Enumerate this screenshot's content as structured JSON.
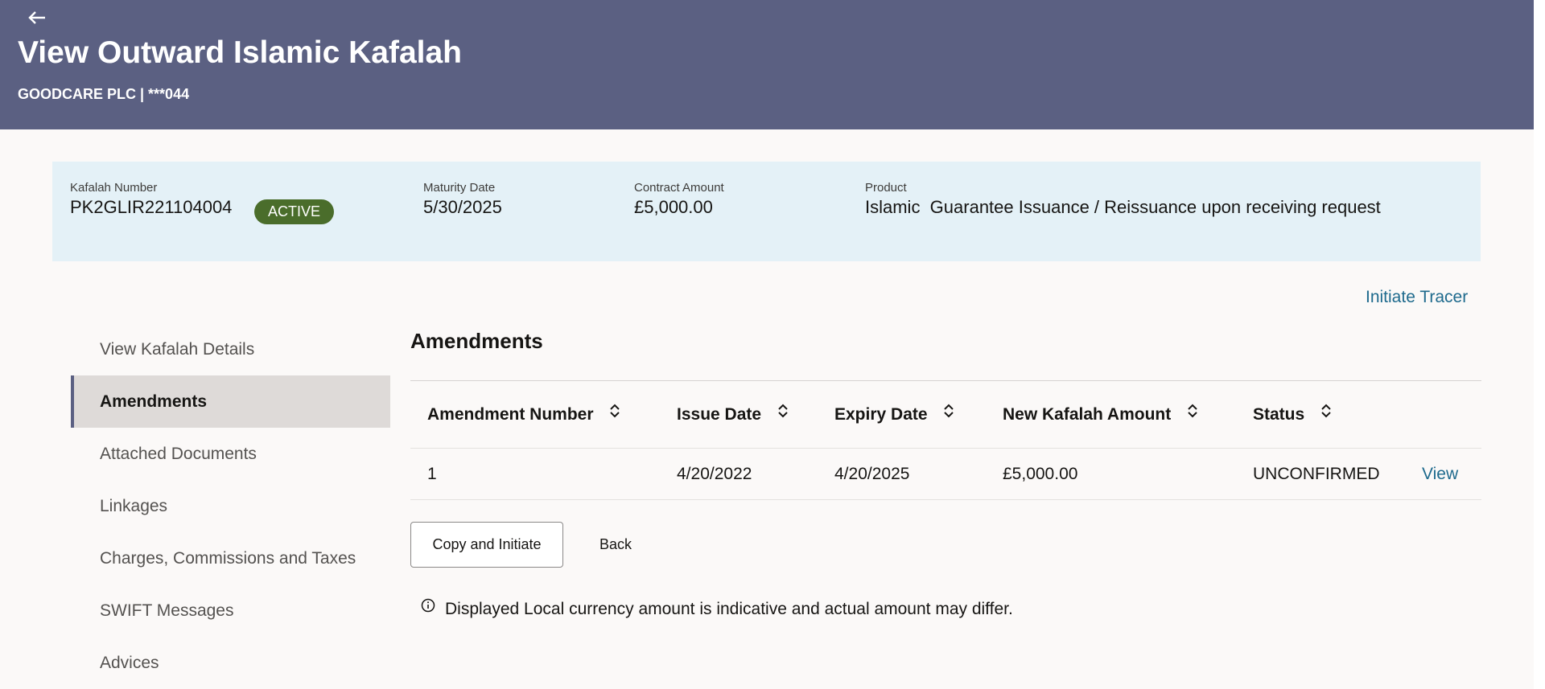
{
  "header": {
    "title": "View Outward Islamic Kafalah",
    "subtitle": "GOODCARE PLC | ***044",
    "back_icon": "back-arrow-icon"
  },
  "summary": {
    "kafalah_number_label": "Kafalah Number",
    "kafalah_number": "PK2GLIR221104004",
    "status_badge": "ACTIVE",
    "maturity_date_label": "Maturity Date",
    "maturity_date": "5/30/2025",
    "contract_amount_label": "Contract Amount",
    "contract_amount": "£5,000.00",
    "product_label": "Product",
    "product": "Islamic  Guarantee Issuance / Reissuance upon receiving request"
  },
  "actions": {
    "initiate_tracer": "Initiate Tracer"
  },
  "sidebar": {
    "items": [
      {
        "label": "View Kafalah Details",
        "active": false
      },
      {
        "label": "Amendments",
        "active": true
      },
      {
        "label": "Attached Documents",
        "active": false
      },
      {
        "label": "Linkages",
        "active": false
      },
      {
        "label": "Charges, Commissions and Taxes",
        "active": false
      },
      {
        "label": "SWIFT Messages",
        "active": false
      },
      {
        "label": "Advices",
        "active": false
      }
    ]
  },
  "main": {
    "section_title": "Amendments",
    "table": {
      "columns": [
        "Amendment Number",
        "Issue Date",
        "Expiry Date",
        "New Kafalah Amount",
        "Status"
      ],
      "rows": [
        {
          "amendment_number": "1",
          "issue_date": "4/20/2022",
          "expiry_date": "4/20/2025",
          "new_amount": "£5,000.00",
          "status": "UNCONFIRMED",
          "action": "View"
        }
      ]
    },
    "buttons": {
      "copy_and_initiate": "Copy and Initiate",
      "back": "Back"
    },
    "note": "Displayed Local currency amount is indicative and actual amount may differ."
  },
  "colors": {
    "header_bg": "#5b6082",
    "summary_bg": "#e4f1f7",
    "badge_bg": "#4a6d2b",
    "link": "#1e6a8d",
    "active_nav_bg": "#dedad8"
  }
}
